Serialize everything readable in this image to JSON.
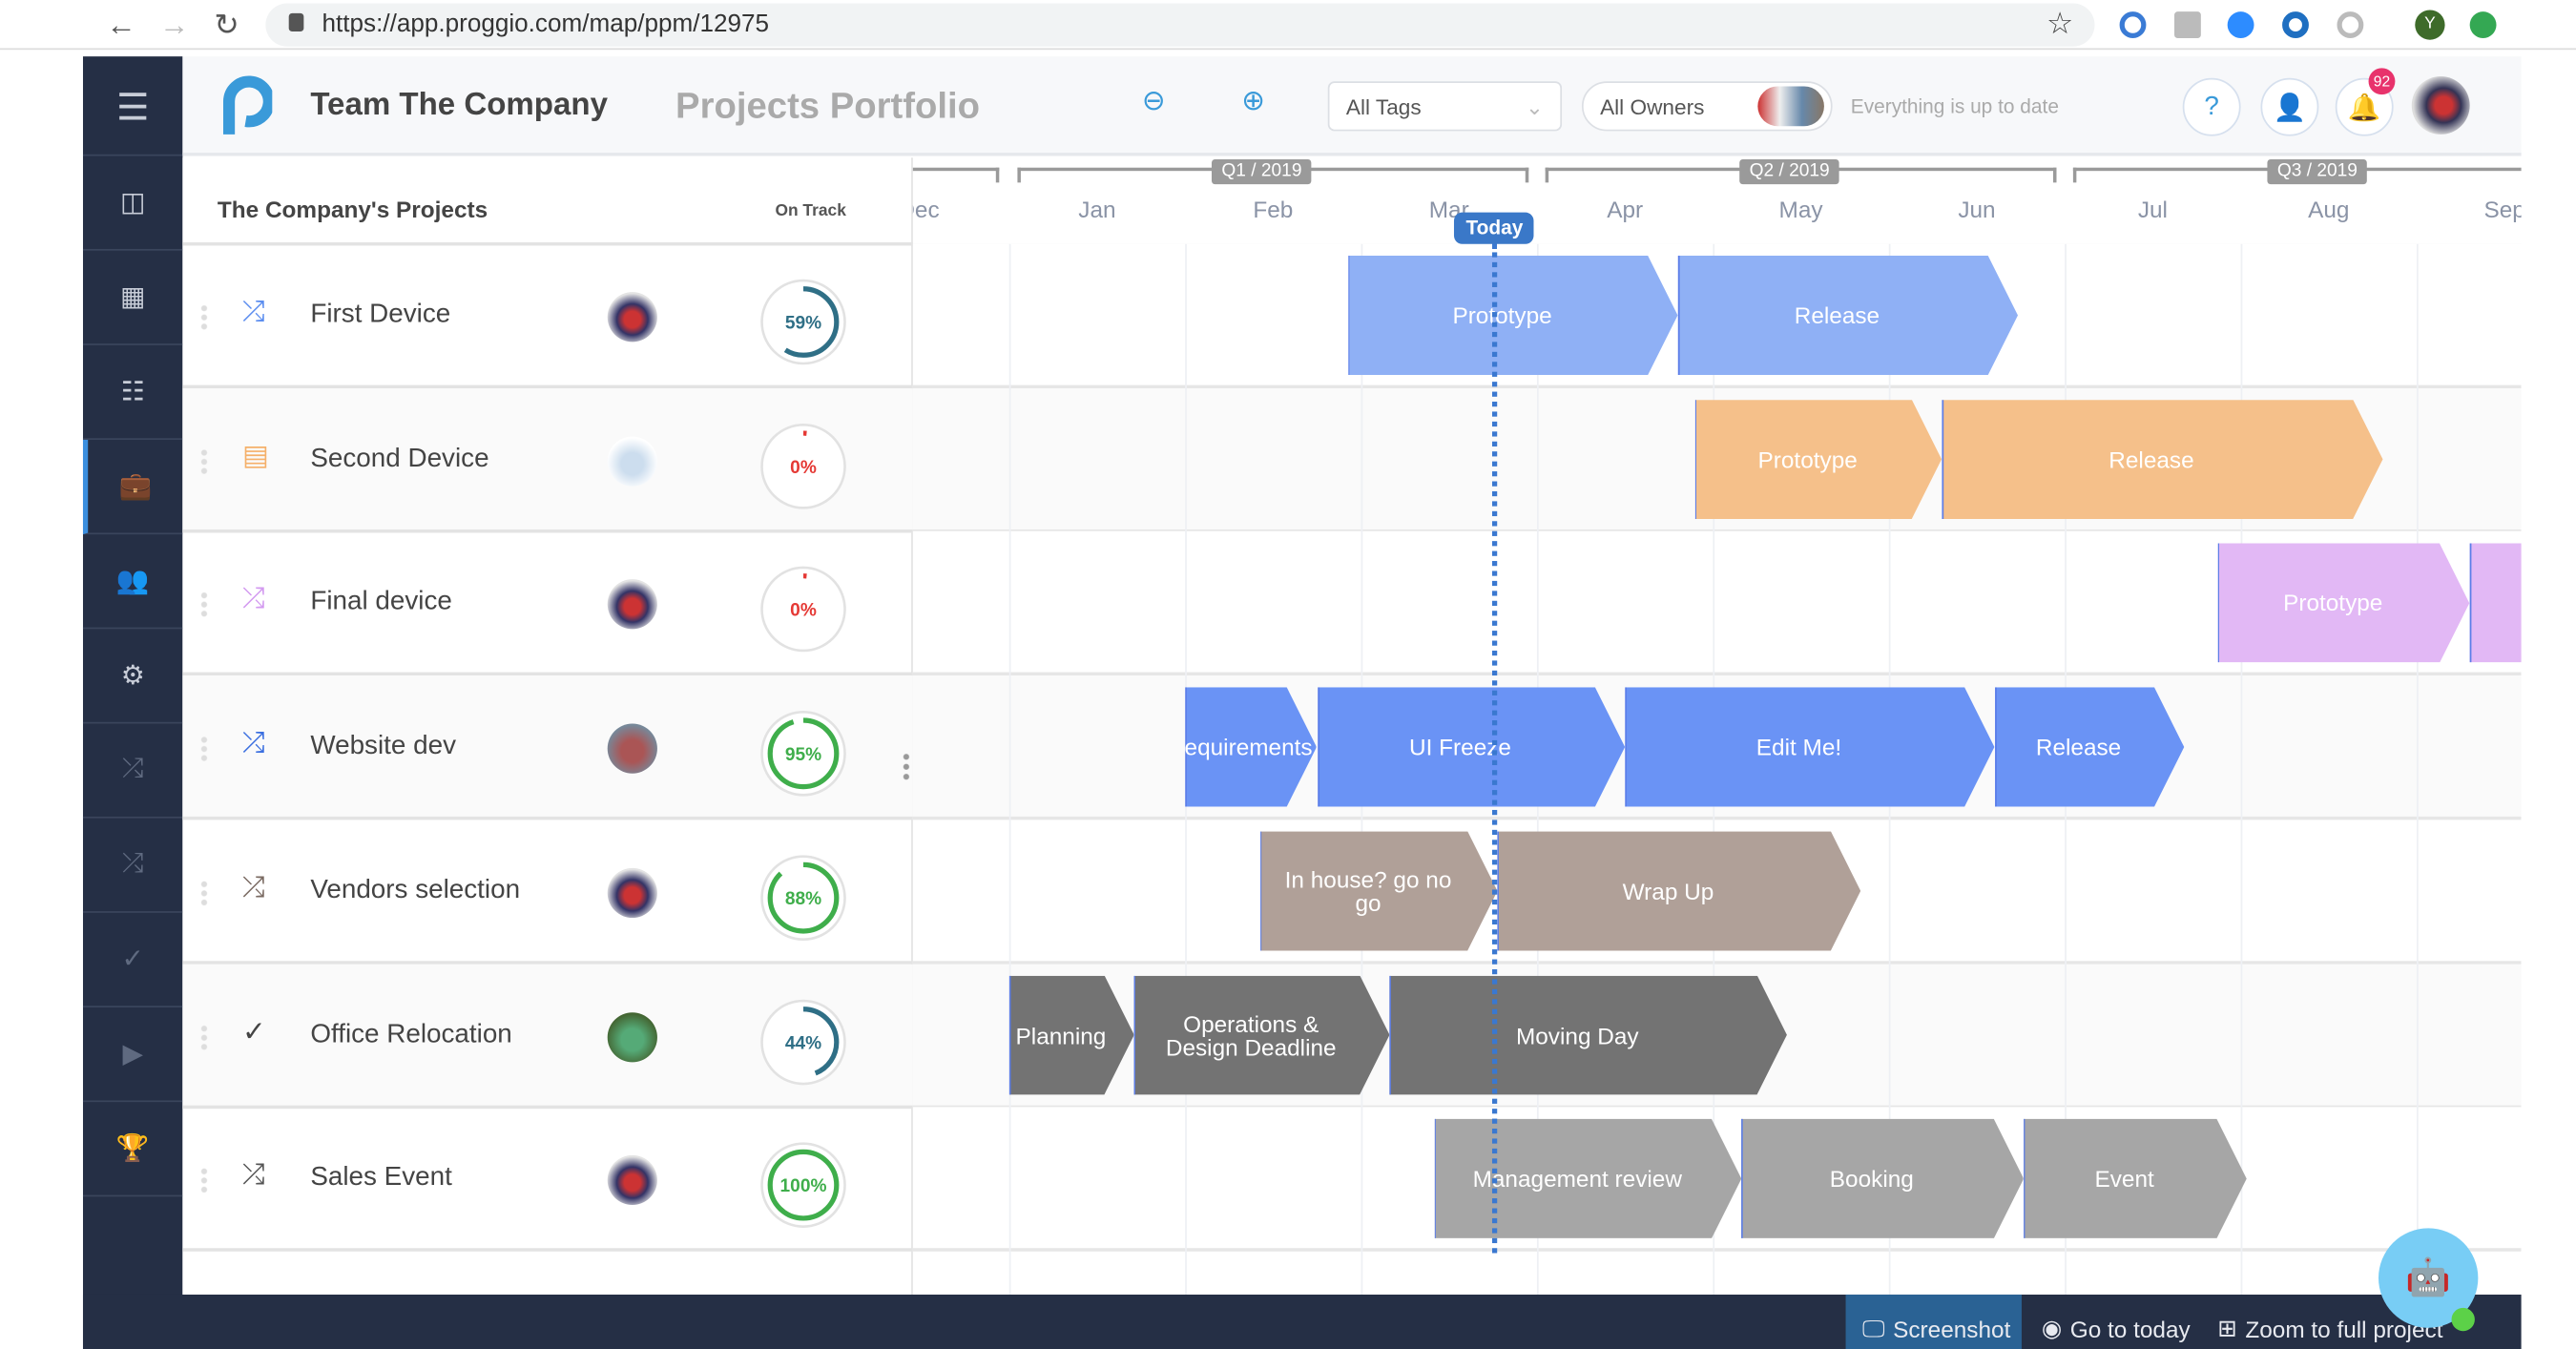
{
  "browser": {
    "url": "https://app.proggio.com/map/ppm/12975",
    "profile_initial": "Y"
  },
  "header": {
    "team": "Team The Company",
    "title": "Projects Portfolio",
    "tags_select": "All Tags",
    "owners_select": "All Owners",
    "status": "Everything is up to date",
    "notifications": "92"
  },
  "sidebar": {
    "items": [
      "menu-icon",
      "columns-icon",
      "grid-icon",
      "list-icon",
      "briefcase-icon",
      "users-icon",
      "gears-icon",
      "shuffle-icon",
      "shuffle-icon",
      "check-icon",
      "video-icon",
      "trophy-icon"
    ],
    "active": "briefcase-icon"
  },
  "panel": {
    "title": "The Company's Projects",
    "on_track_label": "On Track"
  },
  "timeline": {
    "months": [
      "Dec",
      "Jan",
      "Feb",
      "Mar",
      "Apr",
      "May",
      "Jun",
      "Jul",
      "Aug",
      "Sep"
    ],
    "quarters": [
      "Q1 / 2019",
      "Q2 / 2019",
      "Q3 / 2019"
    ],
    "today_label": "Today",
    "today": "2019-03-24"
  },
  "projects": [
    {
      "name": "First Device",
      "icon": "shuffle-icon",
      "icon_color": "#5b8def",
      "progress": 59,
      "progress_label": "59%",
      "ring_color": "#2f6f86",
      "bar_color": "#8fb0f5",
      "phases": [
        {
          "label": "Prototype",
          "start": "2019-02-27",
          "end": "2019-04-24"
        },
        {
          "label": "Release",
          "start": "2019-04-25",
          "end": "2019-06-22"
        }
      ]
    },
    {
      "name": "Second Device",
      "icon": "calendar-icon",
      "icon_color": "#f5b06a",
      "progress": 0,
      "progress_label": "0%",
      "ring_color": "#e53935",
      "bar_color": "#f5c08a",
      "phases": [
        {
          "label": "Prototype",
          "start": "2019-04-28",
          "end": "2019-06-09"
        },
        {
          "label": "Release",
          "start": "2019-06-10",
          "end": "2019-08-25"
        }
      ]
    },
    {
      "name": "Final device",
      "icon": "shuffle-icon",
      "icon_color": "#d39af0",
      "progress": 0,
      "progress_label": "0%",
      "ring_color": "#e53935",
      "bar_color": "#e2b8f5",
      "phases": [
        {
          "label": "Prototype",
          "start": "2019-07-28",
          "end": "2019-09-09"
        },
        {
          "label": "",
          "start": "2019-09-10",
          "end": "2019-10-25"
        }
      ]
    },
    {
      "name": "Website dev",
      "icon": "shuffle-icon",
      "icon_color": "#3b6fe0",
      "progress": 95,
      "progress_label": "95%",
      "ring_color": "#3fae4b",
      "bar_color": "#6a93f5",
      "phases": [
        {
          "label": "Requirements",
          "start": "2019-02-01",
          "end": "2019-02-21"
        },
        {
          "label": "UI Freeze",
          "start": "2019-02-22",
          "end": "2019-04-15"
        },
        {
          "label": "Edit Me!",
          "start": "2019-04-16",
          "end": "2019-06-18"
        },
        {
          "label": "Release",
          "start": "2019-06-19",
          "end": "2019-07-21"
        }
      ]
    },
    {
      "name": "Vendors selection",
      "icon": "shuffle-icon",
      "icon_color": "#7a6a62",
      "progress": 88,
      "progress_label": "88%",
      "ring_color": "#3fae4b",
      "bar_color": "#b0a098",
      "phases": [
        {
          "label": "In house? go no go",
          "start": "2019-02-13",
          "end": "2019-03-24"
        },
        {
          "label": "Wrap Up",
          "start": "2019-03-25",
          "end": "2019-05-26"
        }
      ]
    },
    {
      "name": "Office Relocation",
      "icon": "check-icon",
      "icon_color": "#444444",
      "progress": 44,
      "progress_label": "44%",
      "ring_color": "#2f6f86",
      "bar_color": "#737373",
      "phases": [
        {
          "label": "Planning",
          "start": "2019-01-01",
          "end": "2019-01-22"
        },
        {
          "label": "Operations & Design Deadline",
          "start": "2019-01-23",
          "end": "2019-03-05"
        },
        {
          "label": "Moving Day",
          "start": "2019-03-06",
          "end": "2019-05-13"
        }
      ]
    },
    {
      "name": "Sales Event",
      "icon": "shuffle-icon",
      "icon_color": "#555555",
      "progress": 100,
      "progress_label": "100%",
      "ring_color": "#3fae4b",
      "bar_color": "#a6a6a6",
      "phases": [
        {
          "label": "Management review",
          "start": "2019-03-14",
          "end": "2019-05-05"
        },
        {
          "label": "Booking",
          "start": "2019-05-06",
          "end": "2019-06-23"
        },
        {
          "label": "Event",
          "start": "2019-06-24",
          "end": "2019-08-01"
        }
      ]
    }
  ],
  "footer": {
    "screenshot": "Screenshot",
    "go_today": "Go to today",
    "zoom_full": "Zoom to full project"
  }
}
